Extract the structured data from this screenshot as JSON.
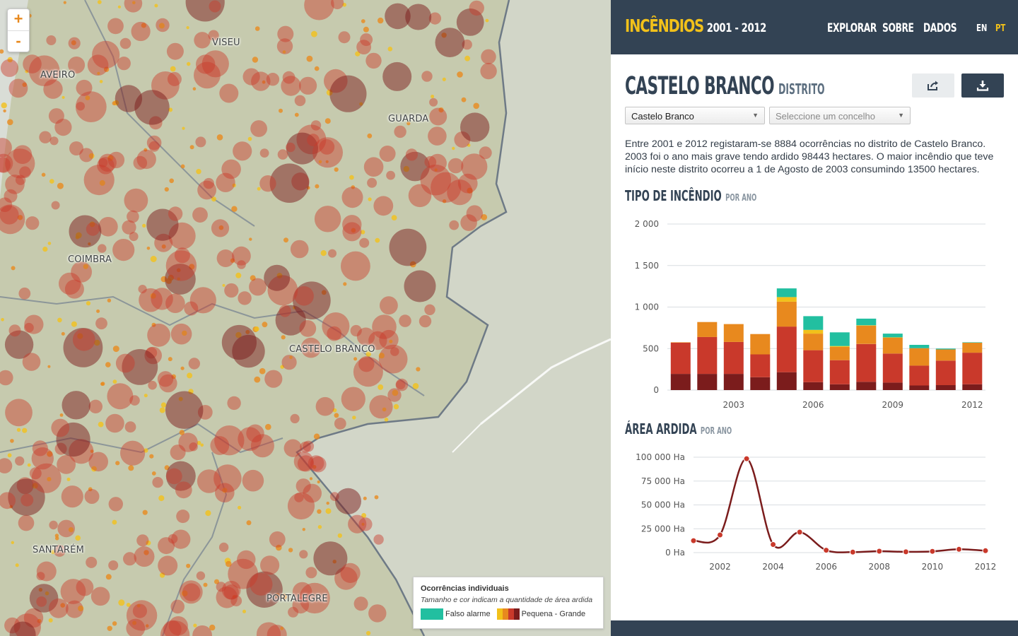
{
  "map": {
    "zoom_in": "+",
    "zoom_out": "-",
    "cities": [
      "AVEIRO",
      "VISEU",
      "GUARDA",
      "COIMBRA",
      "CASTELO BRANCO",
      "SANTARÉM",
      "PORTALEGRE"
    ],
    "legend": {
      "title": "Ocorrências individuais",
      "subtitle": "Tamanho e cor indicam a quantidade de área ardida",
      "false_alarm": "Falso alarme",
      "size_range": "Pequena - Grande"
    }
  },
  "header": {
    "brand": "INCÊNDIOS",
    "years": "2001 - 2012",
    "nav": [
      "EXPLORAR",
      "SOBRE",
      "DADOS"
    ],
    "lang": [
      "EN",
      "PT"
    ]
  },
  "district": {
    "name": "CASTELO BRANCO",
    "type": "DISTRITO",
    "select_district": "Castelo Branco",
    "select_county": "Seleccione um concelho",
    "description": "Entre 2001 e 2012 registaram-se 8884 ocorrências no distrito de Castelo Branco. 2003 foi o ano mais grave tendo ardido 98443 hectares. O maior incêndio que teve início neste distrito ocorreu a 1 de Agosto de 2003 consumindo 13500 hectares."
  },
  "sections": {
    "type_title": "TIPO DE INCÊNDIO",
    "type_sub": "POR ANO",
    "area_title": "ÁREA ARDIDA",
    "area_sub": "POR ANO"
  },
  "colors": {
    "navy": "#334354",
    "yellow": "#f2c11a",
    "teal": "#22bfa0",
    "orange": "#e8891e",
    "red": "#c9392b",
    "darkred": "#7b1c1c"
  },
  "chart_data": [
    {
      "type": "bar",
      "stacked": true,
      "categories": [
        "2001",
        "2002",
        "2003",
        "2004",
        "2005",
        "2006",
        "2007",
        "2008",
        "2009",
        "2010",
        "2011",
        "2012"
      ],
      "x_tick_labels": [
        "2003",
        "2006",
        "2009",
        "2012"
      ],
      "y_tick_labels": [
        "0",
        "500",
        "1 000",
        "1 500",
        "2 000"
      ],
      "ylim": [
        0,
        2000
      ],
      "series": [
        {
          "values": [
            195,
            195,
            195,
            155,
            215,
            95,
            70,
            100,
            90,
            55,
            60,
            70
          ]
        },
        {
          "values": [
            375,
            445,
            385,
            275,
            550,
            385,
            290,
            455,
            350,
            240,
            295,
            380
          ]
        },
        {
          "values": [
            5,
            180,
            215,
            245,
            300,
            200,
            160,
            220,
            190,
            210,
            135,
            120
          ]
        },
        {
          "values": [
            0,
            0,
            0,
            0,
            55,
            45,
            10,
            5,
            5,
            0,
            0,
            0
          ]
        },
        {
          "values": [
            0,
            0,
            0,
            0,
            105,
            165,
            165,
            80,
            45,
            40,
            10,
            5
          ]
        }
      ],
      "grid": true
    },
    {
      "type": "line",
      "x": [
        2001,
        2002,
        2003,
        2004,
        2005,
        2006,
        2007,
        2008,
        2009,
        2010,
        2011,
        2012
      ],
      "y": [
        12500,
        18500,
        98443,
        8500,
        21500,
        2500,
        500,
        1500,
        800,
        1300,
        3500,
        2000
      ],
      "x_tick_labels": [
        "2002",
        "2004",
        "2006",
        "2008",
        "2010",
        "2012"
      ],
      "y_tick_labels": [
        "0 Ha",
        "25 000 Ha",
        "50 000 Ha",
        "75 000 Ha",
        "100 000 Ha"
      ],
      "ylim": [
        0,
        100000
      ],
      "grid": true
    }
  ]
}
